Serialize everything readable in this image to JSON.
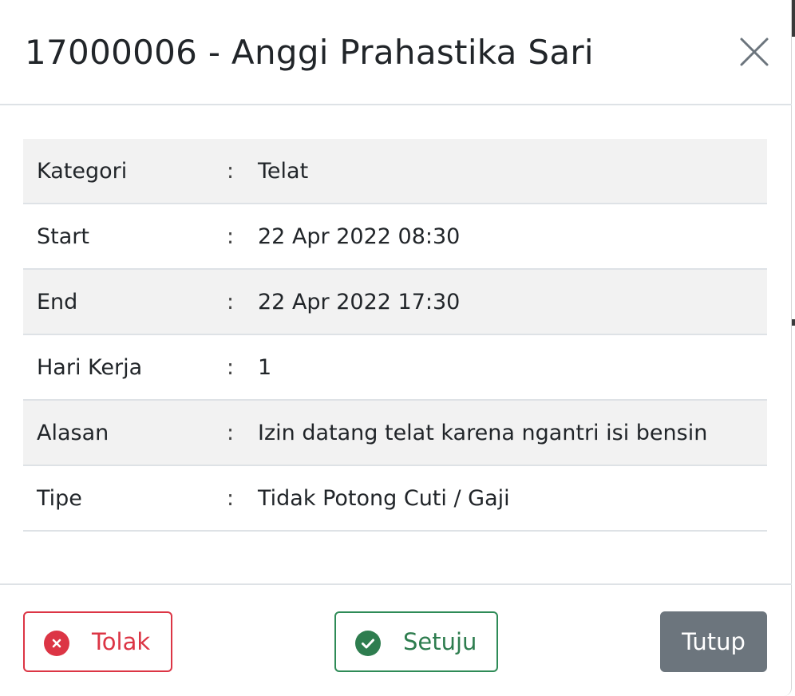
{
  "modal": {
    "title": "17000006 - Anggi Prahastika Sari",
    "close_icon": "close-icon"
  },
  "details": [
    {
      "label": "Kategori",
      "separator": ":",
      "value": "Telat"
    },
    {
      "label": "Start",
      "separator": ":",
      "value": "22 Apr 2022 08:30"
    },
    {
      "label": "End",
      "separator": ":",
      "value": "22 Apr 2022 17:30"
    },
    {
      "label": "Hari Kerja",
      "separator": ":",
      "value": "1"
    },
    {
      "label": "Alasan",
      "separator": ":",
      "value": "Izin datang telat karena ngantri isi bensin"
    },
    {
      "label": "Tipe",
      "separator": ":",
      "value": "Tidak Potong Cuti / Gaji"
    }
  ],
  "footer": {
    "reject_label": "Tolak",
    "reject_icon": "times-circle-icon",
    "approve_label": "Setuju",
    "approve_icon": "check-circle-icon",
    "close_label": "Tutup"
  },
  "colors": {
    "reject": "#dc3545",
    "approve": "#2e8b57",
    "close_button": "#6c757d",
    "striped_row": "#f2f2f2"
  }
}
